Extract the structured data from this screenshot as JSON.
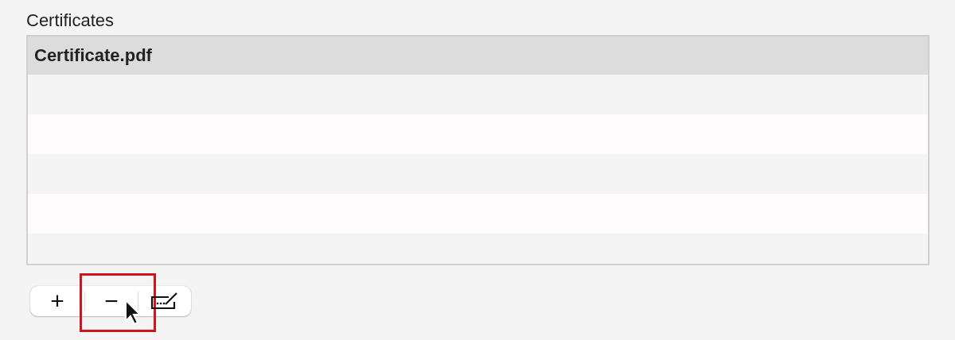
{
  "section_label": "Certificates",
  "files": [
    {
      "name": "Certificate.pdf",
      "selected": true
    }
  ],
  "buttons": [
    {
      "kind": "text",
      "label": "+",
      "highlighted": false
    },
    {
      "kind": "text",
      "label": "−",
      "highlighted": true
    },
    {
      "kind": "signature"
    }
  ]
}
